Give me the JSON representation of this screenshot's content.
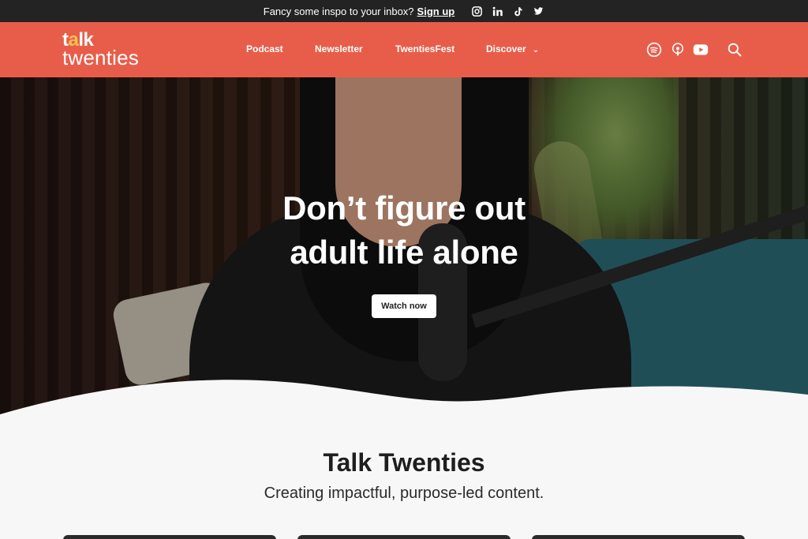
{
  "promo": {
    "message": "Fancy some inspo to your inbox?",
    "signup_label": "Sign up",
    "socials": [
      "instagram-icon",
      "linkedin-icon",
      "tiktok-icon",
      "twitter-icon"
    ]
  },
  "header": {
    "logo_line1_a": "t",
    "logo_line1_dot": "a",
    "logo_line1_b": "lk",
    "logo_line2": "twenties",
    "nav": [
      {
        "label": "Podcast"
      },
      {
        "label": "Newsletter"
      },
      {
        "label": "TwentiesFest"
      },
      {
        "label": "Discover"
      }
    ],
    "icons": [
      "spotify-icon",
      "apple-podcasts-icon",
      "youtube-icon",
      "search-icon"
    ],
    "background": "#e85d4a"
  },
  "hero": {
    "title_line1": "Don’t figure out",
    "title_line2": "adult life alone",
    "cta": "Watch now"
  },
  "intro": {
    "title": "Talk Twenties",
    "subtitle": "Creating impactful, purpose-led content."
  }
}
